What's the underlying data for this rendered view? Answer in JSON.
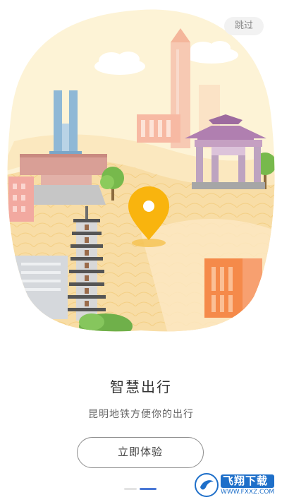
{
  "header": {
    "skip_label": "跳过"
  },
  "illustration": {
    "name": "kunming-landmarks",
    "pin_icon": "location-pin-icon",
    "colors": {
      "background": "#fdf1d2",
      "pin": "#f9b40e",
      "ground": "#f8dba0"
    }
  },
  "content": {
    "title": "智慧出行",
    "subtitle": "昆明地铁方便你的出行",
    "cta_label": "立即体验"
  },
  "pager": {
    "count": 2,
    "active_index": 1
  },
  "watermark": {
    "brand": "飞翔下载",
    "url": "WWW.FXXZ.COM"
  }
}
